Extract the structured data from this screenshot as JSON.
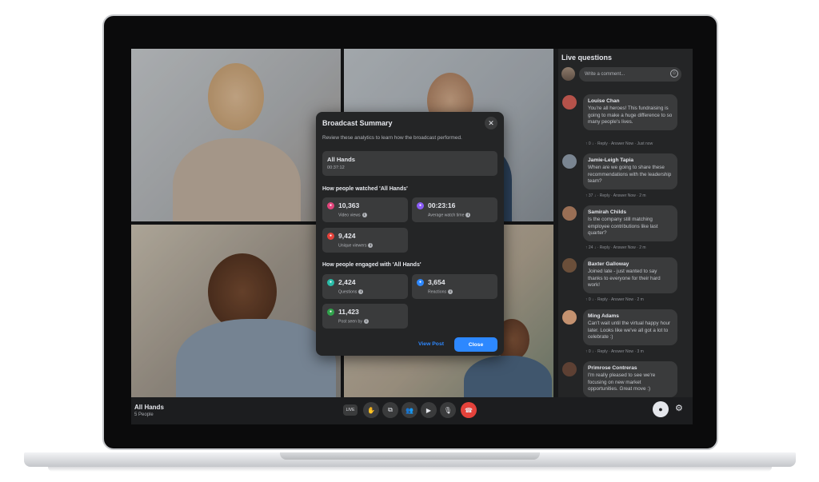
{
  "call": {
    "title": "All Hands",
    "participants": "5 People"
  },
  "controls": [
    {
      "name": "live-icon",
      "glyph": "LIVE"
    },
    {
      "name": "raise-hand-icon",
      "glyph": "✋"
    },
    {
      "name": "share-screen-icon",
      "glyph": "⧉"
    },
    {
      "name": "people-icon",
      "glyph": "👥"
    },
    {
      "name": "camera-icon",
      "glyph": "▶"
    },
    {
      "name": "microphone-icon",
      "glyph": "🎙"
    },
    {
      "name": "end-call-icon",
      "glyph": "☎"
    }
  ],
  "panel": {
    "title": "Live questions",
    "input_placeholder": "Write a comment...",
    "questions": [
      {
        "name": "Louise Chan",
        "text": "You're all heroes! This fundraising is going to make a huge difference to so many people's lives.",
        "meta": "↑ 0 ↓ · Reply · Answer Now · Just now",
        "avatar_color": "#b5524a"
      },
      {
        "name": "Jamie-Leigh Tapia",
        "text": "When are we going to share these recommendations with the leadership team?",
        "meta": "↑ 37 ↓ · Reply · Answer Now · 2 m",
        "avatar_color": "#7a8591"
      },
      {
        "name": "Samirah Childs",
        "text": "Is the company still matching employee contributions like last quarter?",
        "meta": "↑ 24 ↓ · Reply · Answer Now · 2 m",
        "avatar_color": "#9a6f55"
      },
      {
        "name": "Baxter Galloway",
        "text": "Joined late - just wanted to say thanks to everyone for their hard work!",
        "meta": "↑ 0 ↓ · Reply · Answer Now · 2 m",
        "avatar_color": "#6b4f3a"
      },
      {
        "name": "Ming Adams",
        "text": "Can't wait until the virtual happy hour later. Looks like we've all got a lot to celebrate :)",
        "meta": "↑ 0 ↓ · Reply · Answer Now · 3 m",
        "avatar_color": "#c49270"
      },
      {
        "name": "Primrose Contreras",
        "text": "I'm really pleased to see we're focusing on new market opportunities. Great move :)",
        "meta": "",
        "avatar_color": "#5d4033"
      }
    ]
  },
  "modal": {
    "title": "Broadcast Summary",
    "description": "Review these analytics to learn how the broadcast performed.",
    "event": {
      "title": "All Hands",
      "duration": "00:37:12"
    },
    "watched_heading": "How people watched 'All Hands'",
    "engaged_heading": "How people engaged with 'All Hands'",
    "stats": {
      "video_views": {
        "value": "10,363",
        "label": "Video views",
        "color": "#e0457b"
      },
      "avg_watch_time": {
        "value": "00:23:16",
        "label": "Average watch time",
        "color": "#8a5cf6"
      },
      "unique_viewers": {
        "value": "9,424",
        "label": "Unique viewers",
        "color": "#e4423b"
      },
      "questions": {
        "value": "2,424",
        "label": "Questions",
        "color": "#2abba7"
      },
      "reactions": {
        "value": "3,654",
        "label": "Reactions",
        "color": "#2d88ff"
      },
      "post_seen_by": {
        "value": "11,423",
        "label": "Post seen by",
        "color": "#31a24c"
      }
    },
    "view_post_label": "View Post",
    "close_label": "Close"
  }
}
